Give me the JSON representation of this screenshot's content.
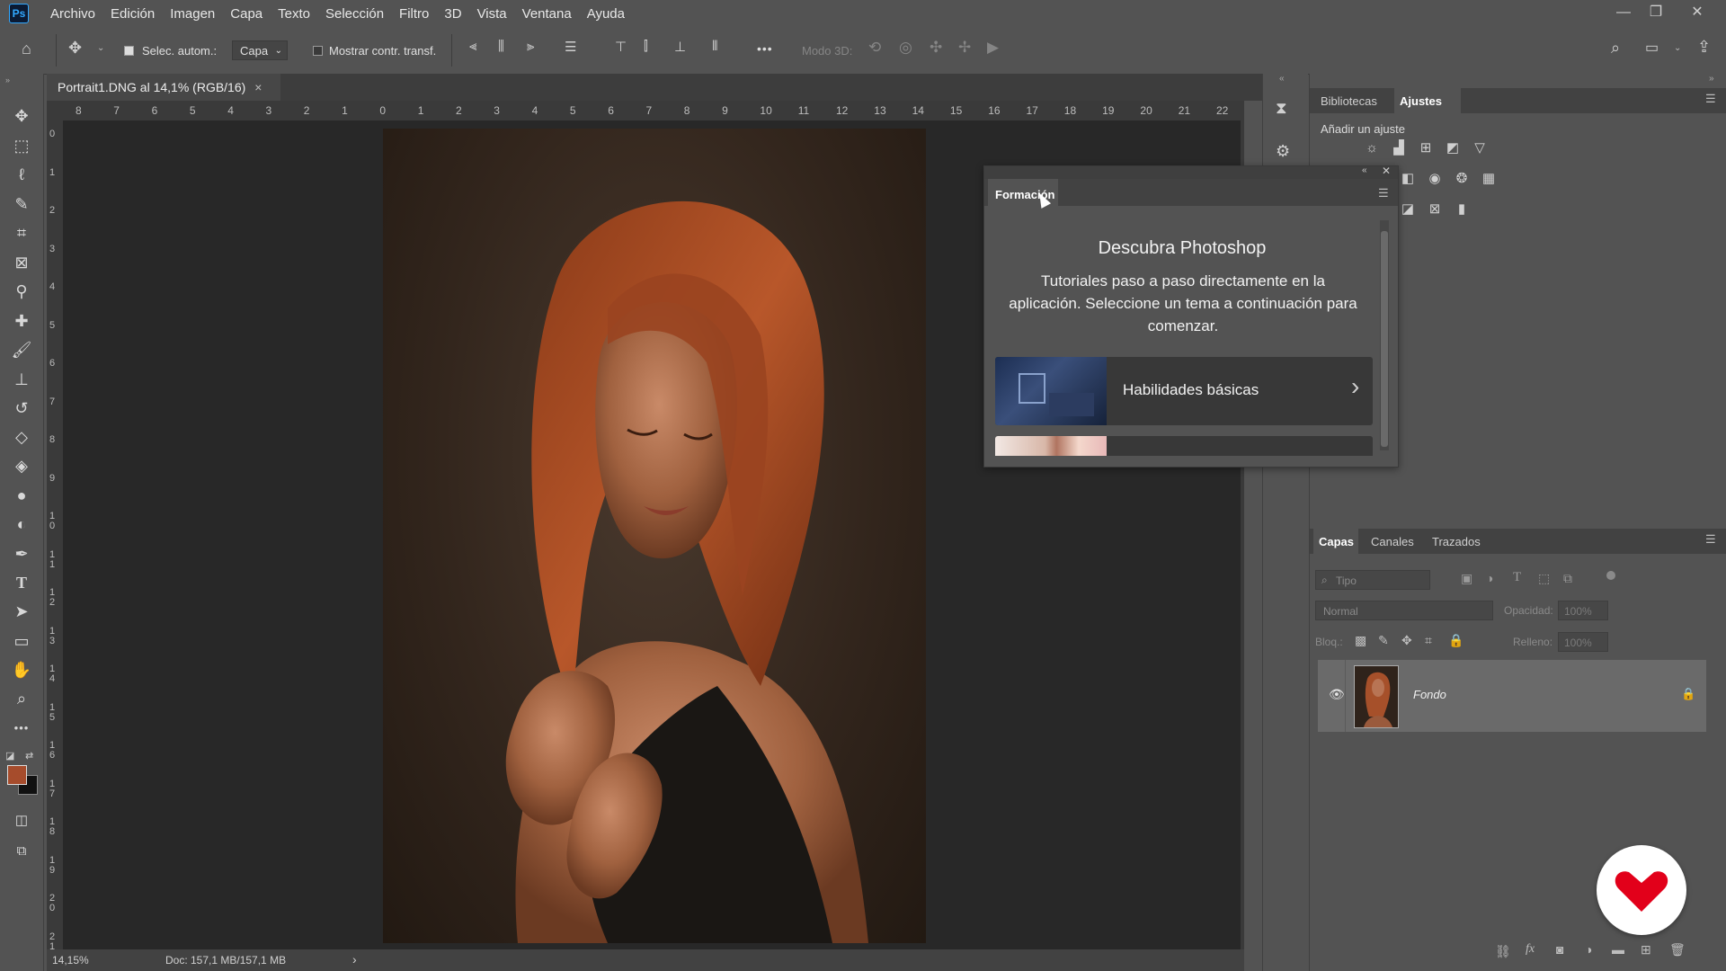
{
  "app": {
    "logo": "Ps"
  },
  "menu": [
    "Archivo",
    "Edición",
    "Imagen",
    "Capa",
    "Texto",
    "Selección",
    "Filtro",
    "3D",
    "Vista",
    "Ventana",
    "Ayuda"
  ],
  "options": {
    "auto_select_label": "Selec. autom.:",
    "auto_select_value": "Capa",
    "show_transform_label": "Mostrar contr. transf.",
    "mode3d_label": "Modo 3D:",
    "more": "•••"
  },
  "document": {
    "tab_title": "Portrait1.DNG al 14,1% (RGB/16)",
    "close": "×",
    "zoom": "14,15%",
    "doc_info": "Doc: 157,1 MB/157,1 MB",
    "status_arrow": "›"
  },
  "ruler": {
    "h": [
      "8",
      "7",
      "6",
      "5",
      "4",
      "3",
      "2",
      "1",
      "0",
      "1",
      "2",
      "3",
      "4",
      "5",
      "6",
      "7",
      "8",
      "9",
      "10",
      "11",
      "12",
      "13",
      "14",
      "15",
      "16",
      "17",
      "18",
      "19",
      "20",
      "21",
      "22"
    ],
    "v": [
      "0",
      "1",
      "2",
      "3",
      "4",
      "5",
      "6",
      "7",
      "8",
      "9",
      "1 0",
      "1 1",
      "1 2",
      "1 3",
      "1 4",
      "1 5",
      "1 6",
      "1 7",
      "1 8",
      "1 9",
      "2 0",
      "2 1"
    ]
  },
  "colors": {
    "foreground": "#a64c2c",
    "background": "#111111",
    "accent": "#31a8ff",
    "badge": "#e2001a"
  },
  "learn_panel": {
    "tab": "Formación",
    "title": "Descubra Photoshop",
    "description": "Tutoriales paso a paso directamente en la aplicación. Seleccione un tema a continuación para comenzar.",
    "card1": "Habilidades básicas",
    "chevron": "›"
  },
  "adjustments": {
    "tabs": [
      "Bibliotecas",
      "Ajustes"
    ],
    "active_tab": "Ajustes",
    "add_label": "Añadir un ajuste"
  },
  "layers": {
    "tabs": [
      "Capas",
      "Canales",
      "Trazados"
    ],
    "active_tab": "Capas",
    "filter_placeholder": "Tipo",
    "blend_mode": "Normal",
    "opacity_label": "Opacidad:",
    "opacity_value": "100%",
    "lock_label": "Bloq.:",
    "fill_label": "Relleno:",
    "fill_value": "100%",
    "items": [
      {
        "name": "Fondo",
        "visible": true,
        "locked": true
      }
    ]
  }
}
